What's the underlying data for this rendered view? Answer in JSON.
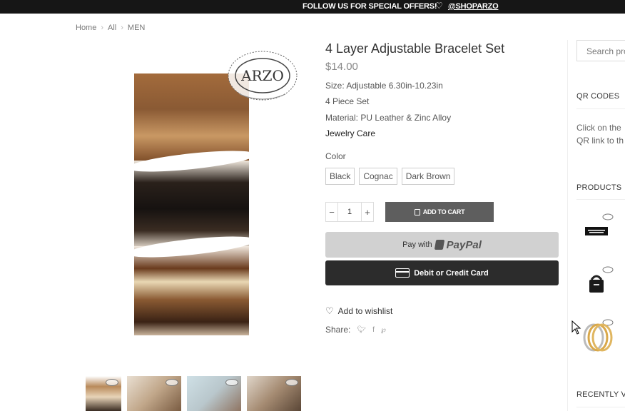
{
  "topbar": {
    "promo_text": "FOLLOW US FOR SPECIAL OFFERS!",
    "heart_icon": "heart-outline-icon",
    "handle": "@SHOPARZO"
  },
  "breadcrumb": {
    "items": [
      "Home",
      "All",
      "MEN"
    ],
    "separator": "›"
  },
  "product": {
    "title": "4 Layer Adjustable Bracelet Set",
    "price": "$14.00",
    "details": [
      "Size: Adjustable 6.30in-10.23in",
      "4 Piece Set",
      "Material: PU Leather & Zinc Alloy"
    ],
    "care_link": "Jewelry Care",
    "color_label": "Color",
    "colors": [
      "Black",
      "Cognac",
      "Dark Brown"
    ],
    "quantity": "1",
    "add_to_cart": "ADD TO CART",
    "paypal": {
      "prefix": "Pay with",
      "brand": "PayPal"
    },
    "card_button": "Debit or Credit Card",
    "wishlist": "Add to wishlist",
    "share_label": "Share:",
    "share_icons": [
      "twitter-icon",
      "facebook-icon",
      "pinterest-icon"
    ]
  },
  "sidebar": {
    "search_placeholder": "Search pro",
    "qr_heading": "QR CODES",
    "qr_text_line1": "Click on the",
    "qr_text_line2": "QR link to th",
    "products_heading": "PRODUCTS",
    "recently_heading": "RECENTLY VI"
  },
  "colors": {
    "topbar_bg": "#161616",
    "cart_button": "#5e5e5e",
    "paypal_button": "#d1d1d1",
    "card_button": "#2c2c2c"
  }
}
